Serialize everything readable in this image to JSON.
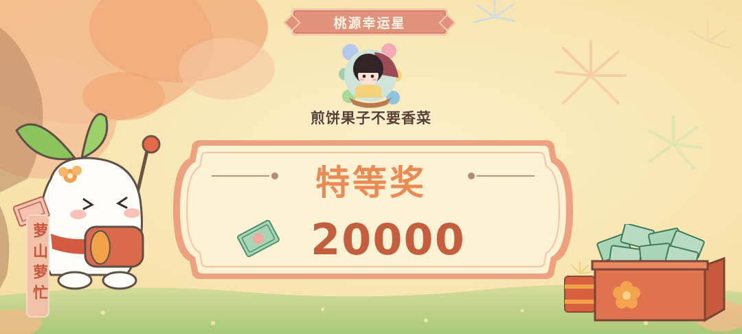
{
  "banner": {
    "title": "桃源幸运星"
  },
  "player": {
    "name": "煎饼果子不要香菜",
    "avatar_icon": "character-portrait-icon"
  },
  "prize": {
    "tier": "特等奖",
    "amount": "20000"
  },
  "side_sign": {
    "text": "萝山萝忙"
  },
  "icons": {
    "mascot": "radish-mascot-icon",
    "cash": "banknote-icon",
    "gift_box": "gift-box-with-money-icon",
    "firecracker": "firecracker-icon",
    "fireworks": "fireworks-icon",
    "tree": "autumn-tree-icon"
  },
  "colors": {
    "background": "#f8e4ad",
    "banner": "#e1927c",
    "prize_title": "#ea8a55",
    "prize_amount": "#c35e3e",
    "panel_fill": "#fdf2d4",
    "panel_border": "#eea17e"
  }
}
